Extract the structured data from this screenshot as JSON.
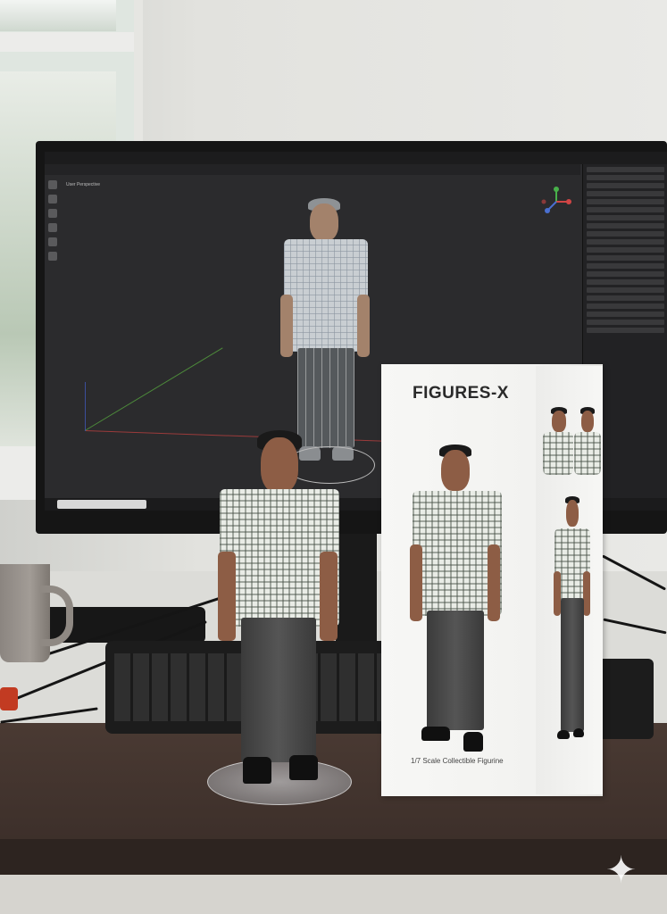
{
  "box": {
    "brand": "FIGURES-X",
    "subtitle": "1/7 Scale Collectible Figurine"
  },
  "screen": {
    "viewport_label": "User Perspective"
  },
  "colors": {
    "desk": "#3b2e29",
    "screen_bg": "#2b2b2d",
    "box": "#f4f4f2"
  },
  "icons": {
    "watermark": "sparkle-icon"
  }
}
